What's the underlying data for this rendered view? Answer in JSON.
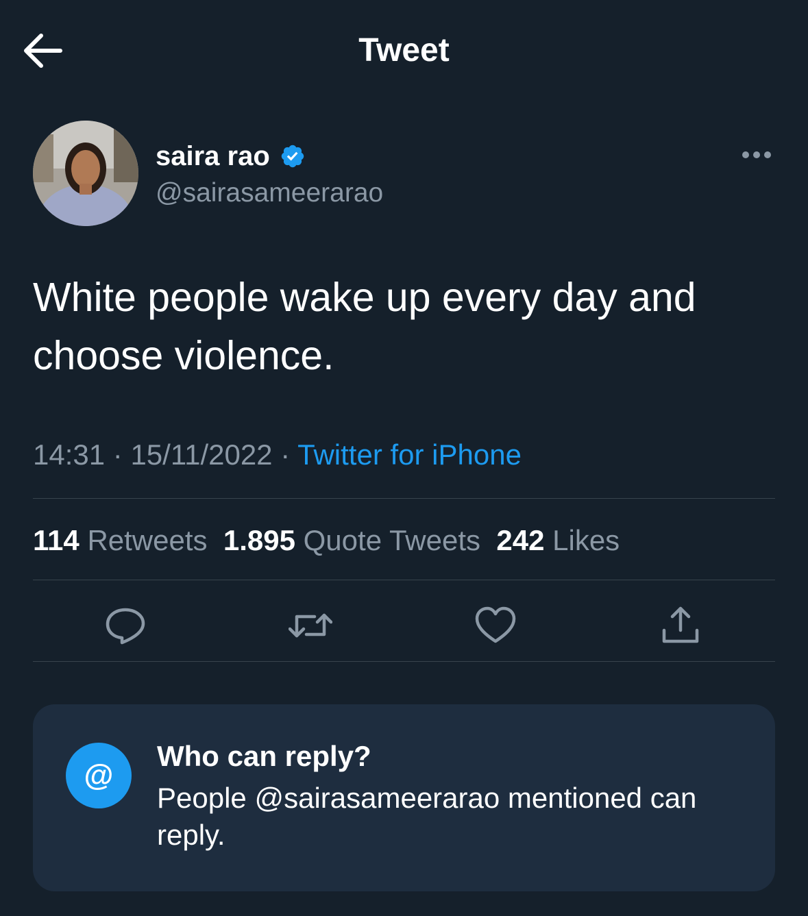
{
  "header": {
    "title": "Tweet",
    "back_icon": "arrow-left-icon"
  },
  "author": {
    "display_name": "saira rao",
    "handle": "@sairasameerarao",
    "verified": true,
    "verified_color": "#1d9bf0"
  },
  "tweet": {
    "text": "White people wake up every day and choose violence.",
    "time": "14:31",
    "separator": "·",
    "date": "15/11/2022",
    "source": "Twitter for iPhone"
  },
  "stats": {
    "retweets_count": "114",
    "retweets_label": "Retweets",
    "quotes_count": "1.895",
    "quotes_label": "Quote Tweets",
    "likes_count": "242",
    "likes_label": "Likes"
  },
  "actions": [
    "reply-icon",
    "retweet-icon",
    "heart-icon",
    "share-icon"
  ],
  "reply_settings": {
    "icon_text": "@",
    "title": "Who can reply?",
    "description": "People @sairasameerarao mentioned can reply."
  },
  "colors": {
    "background": "#15202b",
    "accent": "#1d9bf0",
    "secondary_text": "#8b98a5",
    "card_background": "#1e2d3f",
    "divider": "#38444d"
  }
}
